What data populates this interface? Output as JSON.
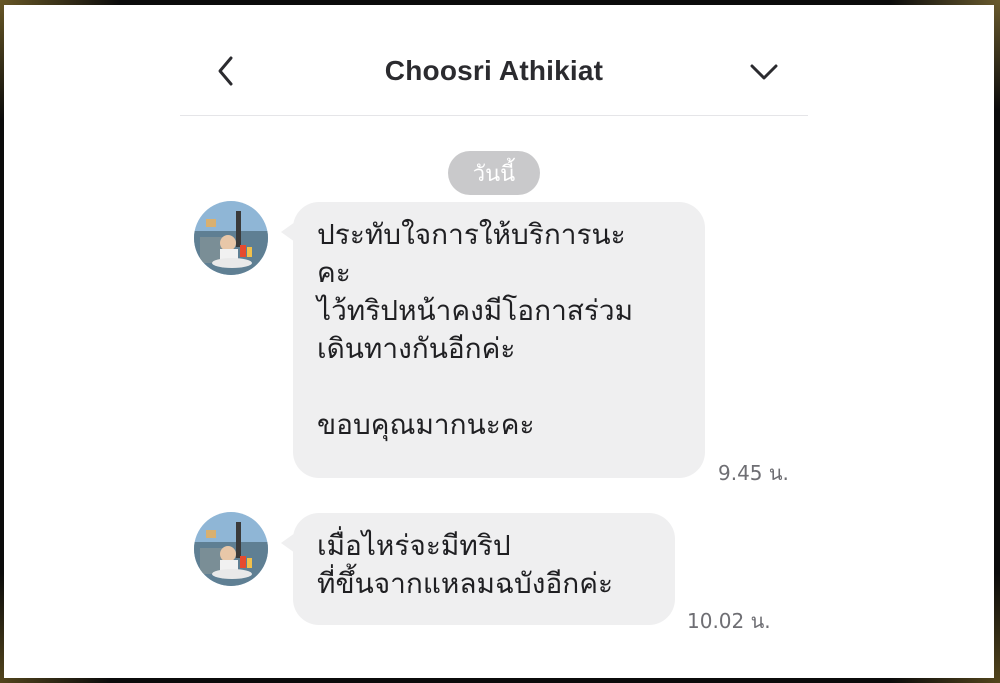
{
  "header": {
    "title": "Choosri Athikiat",
    "back_icon": "chevron-left-icon",
    "menu_icon": "chevron-down-icon"
  },
  "date_separator": "วันนี้",
  "messages": [
    {
      "lines": [
        "ประทับใจการให้บริการนะ",
        "คะ",
        "ไว้ทริปหน้าคงมีโอกาสร่วม",
        "เดินทางกันอีกค่ะ",
        "",
        "ขอบคุณมากนะคะ"
      ],
      "time": "9.45 น."
    },
    {
      "lines": [
        "เมื่อไหร่จะมีทริป",
        "ที่ขึ้นจากแหลมฉบังอีกค่ะ"
      ],
      "time": "10.02 น."
    }
  ],
  "colors": {
    "bubble": "#efeff0",
    "date_pill": "#c9c9cb",
    "title_text": "#2b2b2f",
    "time_text": "#6e6e73"
  }
}
